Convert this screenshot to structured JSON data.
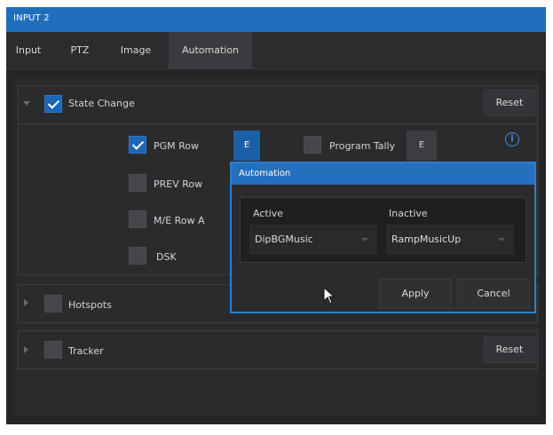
{
  "window": {
    "title": "INPUT 2"
  },
  "tabs": [
    {
      "label": "Input",
      "active": false
    },
    {
      "label": "PTZ",
      "active": false
    },
    {
      "label": "Image",
      "active": false
    },
    {
      "label": "Automation",
      "active": true
    }
  ],
  "state_change": {
    "label": "State Change",
    "checked": true,
    "expanded": true,
    "reset_label": "Reset",
    "rows": [
      {
        "label": "PGM Row",
        "checked": true,
        "e_label": "E"
      },
      {
        "label": "PREV Row",
        "checked": false
      },
      {
        "label": "M/E Row A",
        "checked": false
      },
      {
        "label": "DSK",
        "checked": false
      }
    ],
    "program_tally": {
      "label": "Program Tally",
      "checked": false,
      "e_label": "E"
    },
    "info_icon": "i"
  },
  "hotspots": {
    "label": "Hotspots",
    "checked": false,
    "expanded": false
  },
  "tracker": {
    "label": "Tracker",
    "checked": false,
    "expanded": false,
    "reset_label": "Reset"
  },
  "automation_dialog": {
    "title": "Automation",
    "active_label": "Active",
    "inactive_label": "Inactive",
    "active_value": "DipBGMusic",
    "inactive_value": "RampMusicUp",
    "apply_label": "Apply",
    "cancel_label": "Cancel"
  },
  "colors": {
    "accent": "#1f6fbd",
    "panel": "#262629",
    "checked": "#1c66b5"
  }
}
